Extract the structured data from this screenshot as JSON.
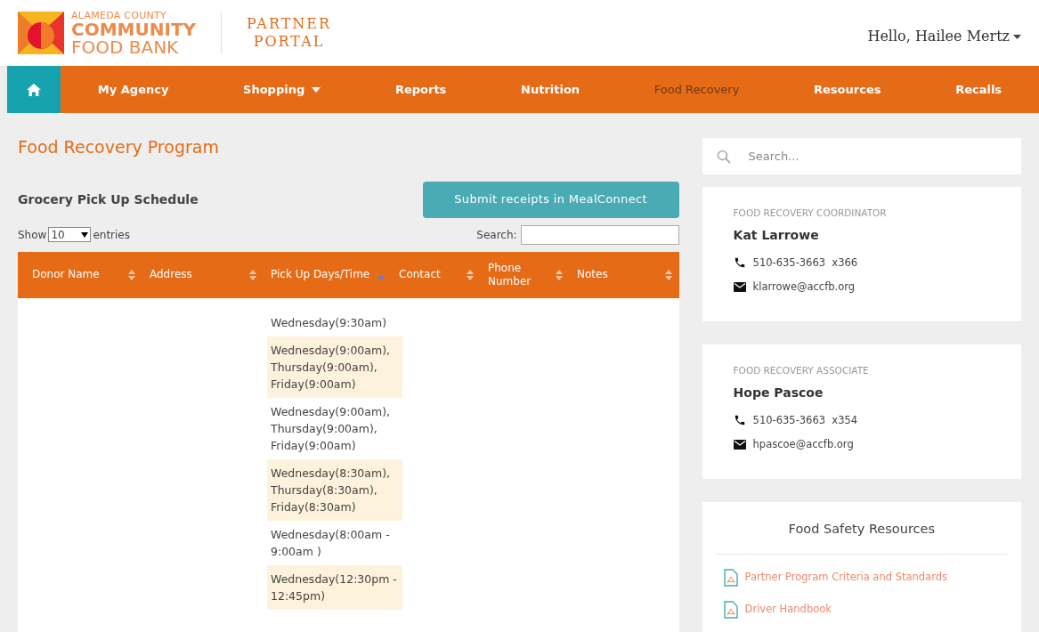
{
  "header": {
    "logo_lines": [
      "ALAMEDA COUNTY",
      "COMMUNITY",
      "FOOD BANK"
    ],
    "portal_lines": [
      "PARTNER",
      "PORTAL"
    ],
    "greeting": "Hello, Hailee Mertz"
  },
  "nav": [
    {
      "label": "My Agency",
      "selected": false,
      "dropdown": false
    },
    {
      "label": "Shopping",
      "selected": false,
      "dropdown": true
    },
    {
      "label": "Reports",
      "selected": false,
      "dropdown": false
    },
    {
      "label": "Nutrition",
      "selected": false,
      "dropdown": false
    },
    {
      "label": "Food Recovery",
      "selected": true,
      "dropdown": false
    },
    {
      "label": "Resources",
      "selected": false,
      "dropdown": false
    },
    {
      "label": "Recalls",
      "selected": false,
      "dropdown": false
    }
  ],
  "page_title": "Food Recovery Program",
  "schedule": {
    "title": "Grocery Pick Up Schedule",
    "button": "Submit receipts in MealConnect",
    "show_label": "Show",
    "page_size": "10",
    "entries_label": "entries",
    "search_label": "Search:",
    "columns": [
      {
        "label": "Donor Name",
        "sorted": false
      },
      {
        "label": "Address",
        "sorted": false
      },
      {
        "label": "Pick Up Days/Time",
        "sorted": true
      },
      {
        "label": "Contact",
        "sorted": false
      },
      {
        "label": "Phone Number",
        "sorted": false
      },
      {
        "label": "Notes",
        "sorted": false
      }
    ],
    "rows": [
      {
        "pickup": "Wednesday(9:30am)",
        "highlighted": false
      },
      {
        "pickup": "Wednesday(9:00am), Thursday(9:00am), Friday(9:00am)",
        "highlighted": true
      },
      {
        "pickup": "Wednesday(9:00am), Thursday(9:00am), Friday(9:00am)",
        "highlighted": false
      },
      {
        "pickup": "Wednesday(8:30am), Thursday(8:30am), Friday(8:30am)",
        "highlighted": true
      },
      {
        "pickup": "Wednesday(8:00am - 9:00am )",
        "highlighted": false
      },
      {
        "pickup": "Wednesday(12:30pm - 12:45pm)",
        "highlighted": true
      }
    ]
  },
  "sidebar": {
    "search_placeholder": "Search...",
    "contacts": [
      {
        "role": "FOOD RECOVERY COORDINATOR",
        "name": "Kat Larrowe",
        "phone": "510-635-3663  x366",
        "email": "klarrowe@accfb.org"
      },
      {
        "role": "FOOD RECOVERY ASSOCIATE",
        "name": "Hope Pascoe",
        "phone": "510-635-3663  x354",
        "email": "hpascoe@accfb.org"
      }
    ],
    "resources": {
      "title": "Food Safety Resources",
      "links": [
        "Partner Program Criteria and Standards",
        "Driver Handbook"
      ]
    }
  }
}
